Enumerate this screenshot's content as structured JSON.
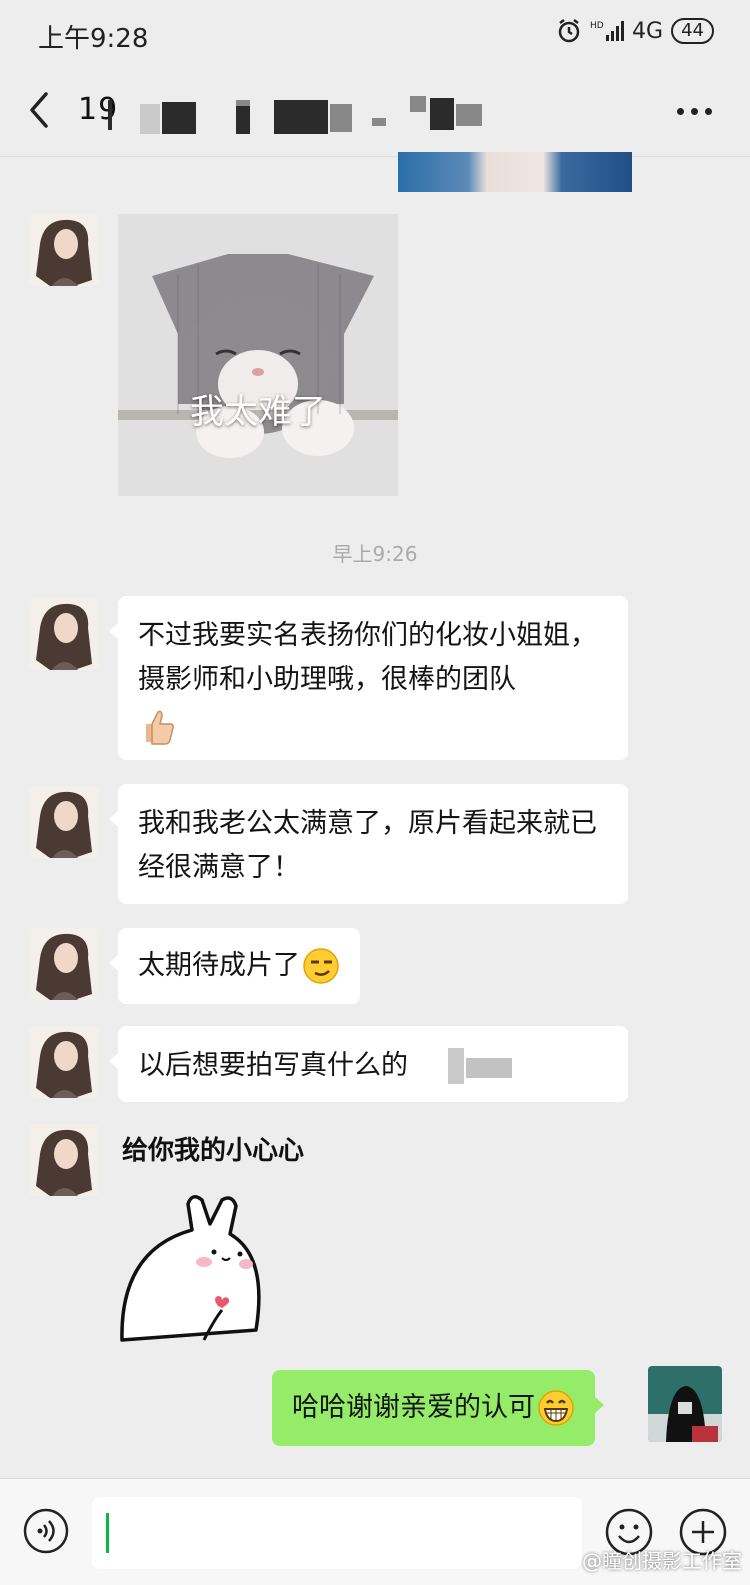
{
  "status_bar": {
    "time": "上午9:28",
    "network": "4G",
    "battery": "44"
  },
  "header": {
    "contact_name": "19"
  },
  "messages": {
    "meme_caption": "我太难了",
    "timestamp": "早上9:26",
    "msg1": "不过我要实名表扬你们的化妆小姐姐，摄影师和小助理哦，很棒的团队",
    "msg2": "我和我老公太满意了，原片看起来就已经很满意了！",
    "msg3": "太期待成片了",
    "msg4": "以后想要拍写真什么的",
    "sticker_caption": "给你我的小心心",
    "reply": "哈哈谢谢亲爱的认可"
  },
  "watermark": "@瞳创摄影工作室",
  "colors": {
    "background": "#ededed",
    "my_bubble": "#95ec69",
    "their_bubble": "#ffffff"
  },
  "icons": [
    "alarm-icon",
    "signal-icon",
    "battery-icon",
    "back-arrow-icon",
    "more-icon",
    "thumbs-up-emoji",
    "smirk-emoji",
    "grin-emoji",
    "voice-icon",
    "emoji-icon",
    "plus-icon"
  ]
}
